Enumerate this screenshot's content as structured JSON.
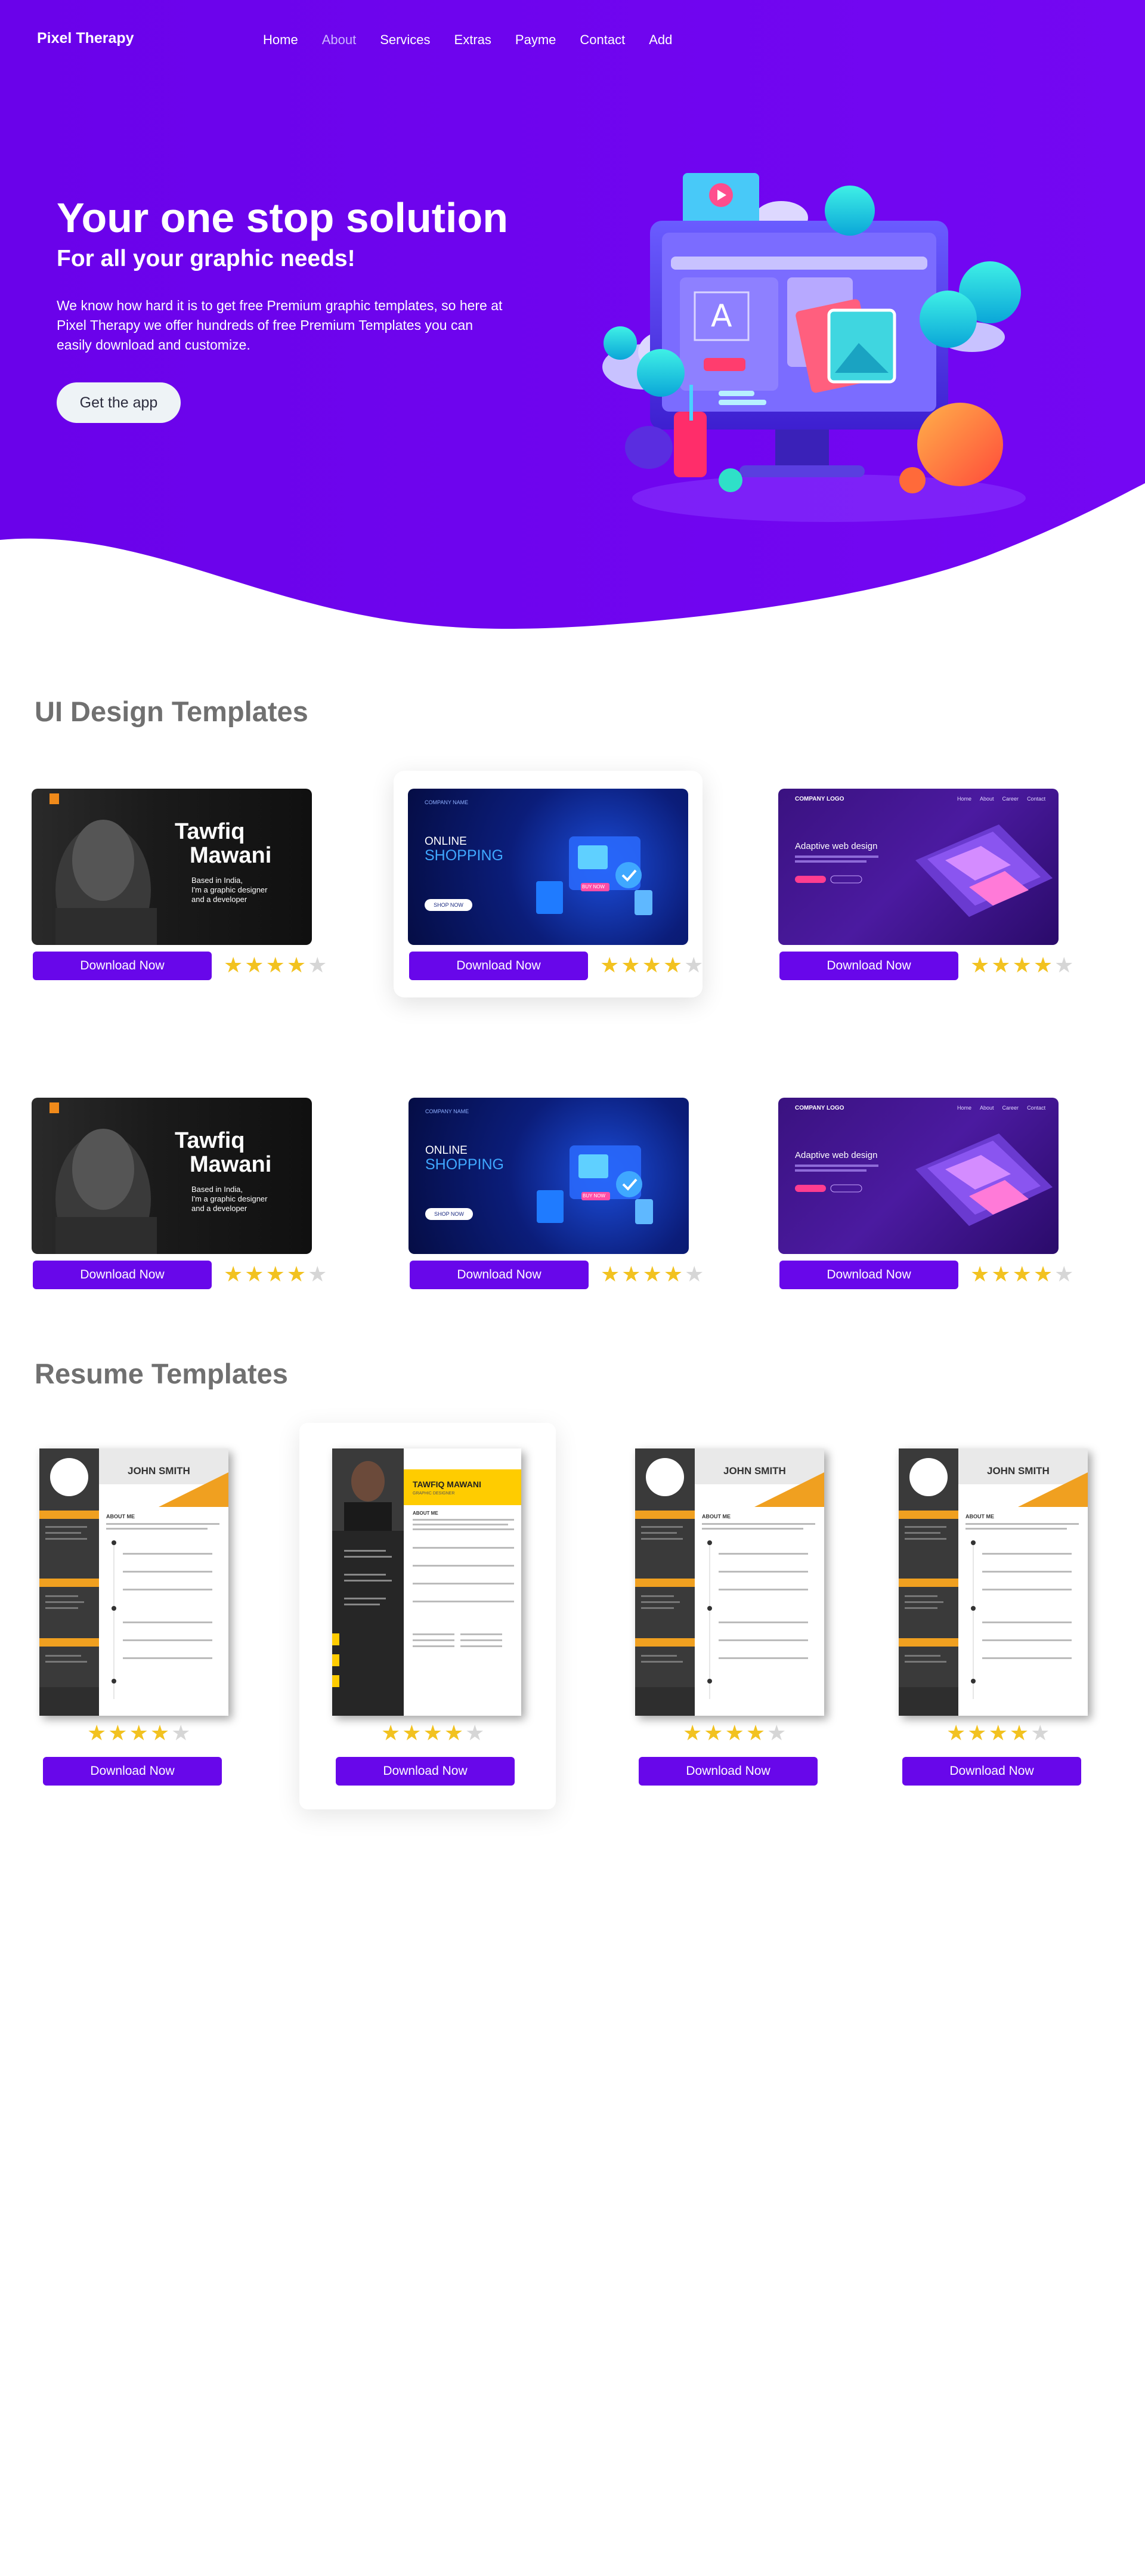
{
  "brand": {
    "name": "Pixel Therapy"
  },
  "nav": {
    "items": [
      {
        "label": "Home"
      },
      {
        "label": "About"
      },
      {
        "label": "Services"
      },
      {
        "label": "Extras"
      },
      {
        "label": "Payme"
      },
      {
        "label": "Contact"
      },
      {
        "label": "Add"
      }
    ],
    "active": "About"
  },
  "hero": {
    "title": "Your one stop solution",
    "subtitle": "For all your graphic needs!",
    "text": "We know how hard it is to get free Premium graphic templates, so here at Pixel Therapy we offer hundreds of free Premium Templates you can easily download and customize.",
    "cta_label": "Get the app"
  },
  "ui_section": {
    "title": "UI Design Templates",
    "cards": [
      {
        "thumb": {
          "heading1": "Tawfiq",
          "heading2": "Mawani",
          "line1": "Based in India,",
          "line2": "I'm a graphic designer",
          "line3": "and a developer"
        },
        "download_label": "Download Now",
        "rating": 4
      },
      {
        "thumb": {
          "line1": "ONLINE",
          "line2": "SHOPPING",
          "badge": "BUY NOW",
          "button": "SHOP NOW",
          "logo": "COMPANY NAME"
        },
        "download_label": "Download Now",
        "rating": 4
      },
      {
        "thumb": {
          "logo": "COMPANY LOGO",
          "nav": [
            "Home",
            "About",
            "Career",
            "Contact"
          ],
          "heading": "Adaptive web design"
        },
        "download_label": "Download Now",
        "rating": 4
      },
      {
        "thumb": {
          "heading1": "Tawfiq",
          "heading2": "Mawani",
          "line1": "Based in India,",
          "line2": "I'm a graphic designer",
          "line3": "and a developer"
        },
        "download_label": "Download Now",
        "rating": 4
      },
      {
        "thumb": {
          "line1": "ONLINE",
          "line2": "SHOPPING",
          "badge": "BUY NOW",
          "button": "SHOP NOW",
          "logo": "COMPANY NAME"
        },
        "download_label": "Download Now",
        "rating": 4
      },
      {
        "thumb": {
          "logo": "COMPANY LOGO",
          "nav": [
            "Home",
            "About",
            "Career",
            "Contact"
          ],
          "heading": "Adaptive web design"
        },
        "download_label": "Download Now",
        "rating": 4
      }
    ]
  },
  "resume_section": {
    "title": "Resume Templates",
    "cards": [
      {
        "name": "JOHN SMITH",
        "about": "ABOUT ME",
        "download_label": "Download Now",
        "rating": 4
      },
      {
        "name": "TAWFIQ MAWANI",
        "role": "GRAPHIC DESIGNER",
        "about": "ABOUT ME",
        "download_label": "Download Now",
        "rating": 4
      },
      {
        "name": "JOHN SMITH",
        "about": "ABOUT ME",
        "download_label": "Download Now",
        "rating": 4
      },
      {
        "name": "JOHN SMITH",
        "about": "ABOUT ME",
        "download_label": "Download Now",
        "rating": 4
      }
    ]
  },
  "colors": {
    "brand_purple": "#6a02ea",
    "button_purple": "#6807ea",
    "star_gold": "#f2c220",
    "accent_orange": "#f0a020",
    "accent_yellow": "#ffcc00"
  }
}
